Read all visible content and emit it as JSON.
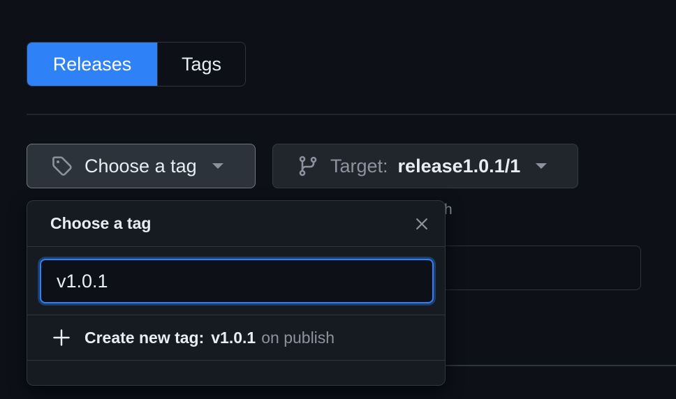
{
  "tabs": {
    "releases_label": "Releases",
    "tags_label": "Tags"
  },
  "tag_picker": {
    "label": "Choose a tag",
    "icon": "tag-icon"
  },
  "target_picker": {
    "prefix": "Target:",
    "value": "release1.0.1/1",
    "icon": "git-branch-icon"
  },
  "background": {
    "hint_fragment": "h"
  },
  "popover": {
    "title": "Choose a tag",
    "filter_value": "v1.0.1",
    "create": {
      "prefix": "Create new tag:",
      "tag": "v1.0.1",
      "suffix": "on publish"
    }
  },
  "colors": {
    "accent": "#2f81f7",
    "background": "#0d1117",
    "overlay": "#161b22",
    "border": "#30363d",
    "muted": "#8b949e"
  }
}
